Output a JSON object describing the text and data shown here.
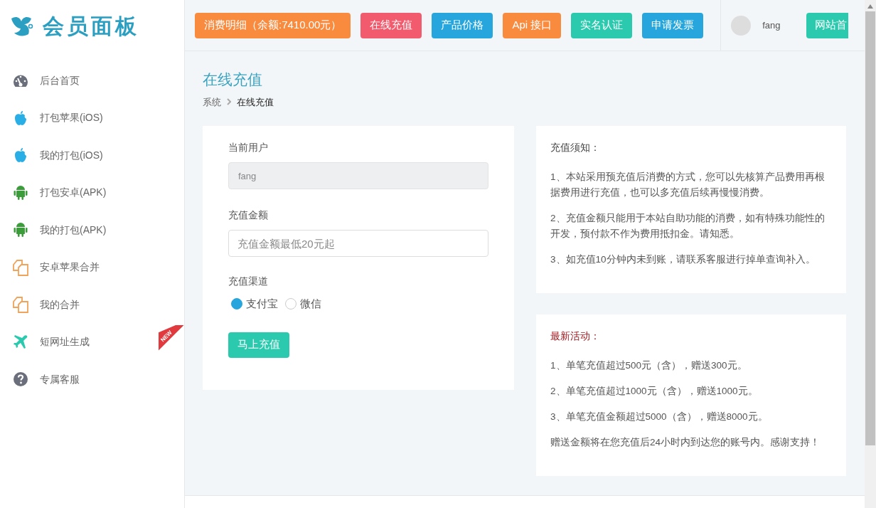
{
  "brand": {
    "title": "会员面板"
  },
  "sidebar": {
    "items": [
      {
        "kind": "dashboard",
        "label": "后台首页"
      },
      {
        "kind": "apple",
        "label": "打包苹果(iOS)"
      },
      {
        "kind": "apple",
        "label": "我的打包(iOS)"
      },
      {
        "kind": "android",
        "label": "打包安卓(APK)"
      },
      {
        "kind": "android",
        "label": "我的打包(APK)"
      },
      {
        "kind": "copy",
        "label": "安卓苹果合并"
      },
      {
        "kind": "copy",
        "label": "我的合并"
      },
      {
        "kind": "plane",
        "label": "短网址生成",
        "badge": "NEW"
      },
      {
        "kind": "help",
        "label": "专属客服"
      }
    ]
  },
  "topbar": {
    "buttons": [
      {
        "label": "消费明细（余额:7410.00元）",
        "color": "#f98b3f"
      },
      {
        "label": "在线充值",
        "color": "#f15b6d"
      },
      {
        "label": "产品价格",
        "color": "#26a6dc"
      },
      {
        "label": "Api 接口",
        "color": "#f98b3f"
      },
      {
        "label": "实名认证",
        "color": "#2bcaae"
      },
      {
        "label": "申请发票",
        "color": "#26a6dc"
      }
    ],
    "user": {
      "name": "fang"
    },
    "cut_button": {
      "label": "网站首",
      "color": "#2bcaae"
    }
  },
  "page": {
    "title": "在线充值",
    "breadcrumb": [
      "系统",
      "在线充值"
    ]
  },
  "form": {
    "user_label": "当前用户",
    "user_value": "fang",
    "amount_label": "充值金额",
    "amount_placeholder": "充值金额最低20元起",
    "channel_label": "充值渠道",
    "channels": [
      {
        "label": "支付宝",
        "selected": true
      },
      {
        "label": "微信",
        "selected": false
      }
    ],
    "submit": "马上充值"
  },
  "notice": {
    "title": "充值须知：",
    "paragraphs": [
      "1、本站采用预充值后消费的方式，您可以先核算产品费用再根据费用进行充值，也可以多充值后续再慢慢消费。",
      "2、充值金额只能用于本站自助功能的消费，如有特殊功能性的开发，预付款不作为费用抵扣金。请知悉。",
      "3、如充值10分钟内未到账，请联系客服进行掉单查询补入。"
    ]
  },
  "promo": {
    "title": "最新活动：",
    "paragraphs": [
      "1、单笔充值超过500元（含），赠送300元。",
      "2、单笔充值超过1000元（含），赠送1000元。",
      "3、单笔充值金额超过5000（含），赠送8000元。",
      "赠送金额将在您充值后24小时内到达您的账号内。感谢支持！"
    ]
  }
}
